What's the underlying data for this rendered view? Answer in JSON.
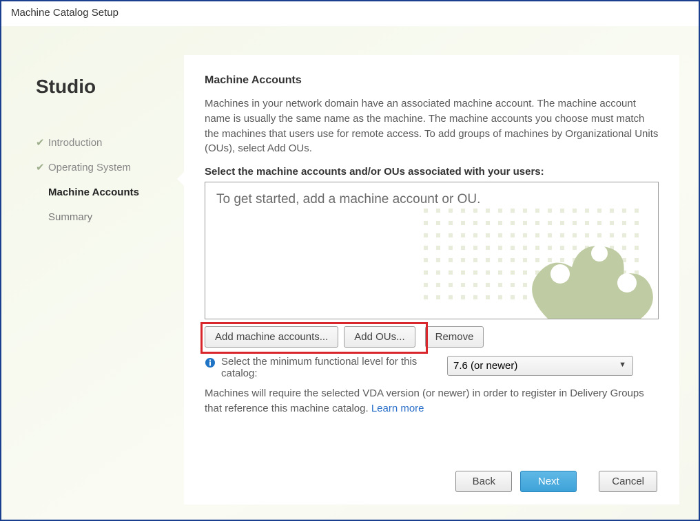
{
  "window": {
    "title": "Machine Catalog Setup"
  },
  "sidebar": {
    "brand": "Studio",
    "steps": [
      {
        "label": "Introduction",
        "done": true
      },
      {
        "label": "Operating System",
        "done": true
      },
      {
        "label": "Machine Accounts",
        "current": true
      },
      {
        "label": "Summary"
      }
    ]
  },
  "main": {
    "heading": "Machine Accounts",
    "description": "Machines in your network domain have an associated machine account. The machine account name is usually the same name as the machine. The machine accounts you choose must match the machines that users use for remote access. To add groups of machines by Organizational Units (OUs), select Add OUs.",
    "select_prompt": "Select the machine accounts and/or OUs associated with your users:",
    "listbox_placeholder": "To get started, add a machine account or OU.",
    "buttons": {
      "add_accounts": "Add machine accounts...",
      "add_ous": "Add OUs...",
      "remove": "Remove"
    },
    "level_label": "Select the minimum functional level for this catalog:",
    "level_options": [
      "7.6 (or newer)"
    ],
    "level_selected": "7.6 (or newer)",
    "vda_note_prefix": "Machines will require the selected VDA version (or newer) in order to register in Delivery Groups that reference this machine catalog. ",
    "learn_more": "Learn more"
  },
  "footer": {
    "back": "Back",
    "next": "Next",
    "cancel": "Cancel"
  }
}
